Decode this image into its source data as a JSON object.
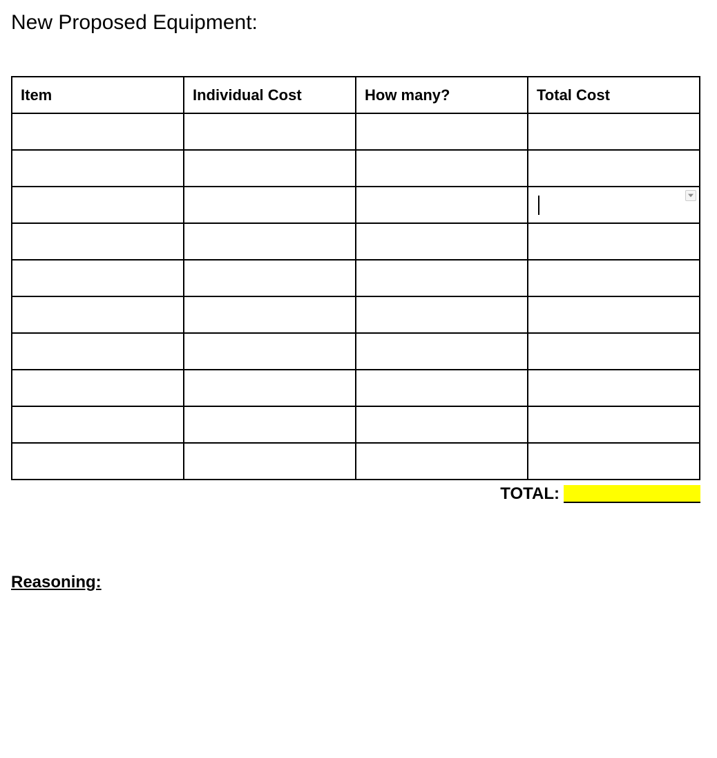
{
  "title": "New Proposed Equipment:",
  "table": {
    "headers": {
      "item": "Item",
      "individual_cost": "Individual Cost",
      "quantity": "How many?",
      "total_cost": "Total Cost"
    },
    "rows": [
      {
        "item": "",
        "individual_cost": "",
        "quantity": "",
        "total_cost": ""
      },
      {
        "item": "",
        "individual_cost": "",
        "quantity": "",
        "total_cost": ""
      },
      {
        "item": "",
        "individual_cost": "",
        "quantity": "",
        "total_cost": ""
      },
      {
        "item": "",
        "individual_cost": "",
        "quantity": "",
        "total_cost": ""
      },
      {
        "item": "",
        "individual_cost": "",
        "quantity": "",
        "total_cost": ""
      },
      {
        "item": "",
        "individual_cost": "",
        "quantity": "",
        "total_cost": ""
      },
      {
        "item": "",
        "individual_cost": "",
        "quantity": "",
        "total_cost": ""
      },
      {
        "item": "",
        "individual_cost": "",
        "quantity": "",
        "total_cost": ""
      },
      {
        "item": "",
        "individual_cost": "",
        "quantity": "",
        "total_cost": ""
      },
      {
        "item": "",
        "individual_cost": "",
        "quantity": "",
        "total_cost": ""
      }
    ],
    "active_cell": {
      "row": 2,
      "col": "total_cost"
    }
  },
  "total": {
    "label": "TOTAL:",
    "value": ""
  },
  "reasoning": {
    "heading": "Reasoning:"
  }
}
